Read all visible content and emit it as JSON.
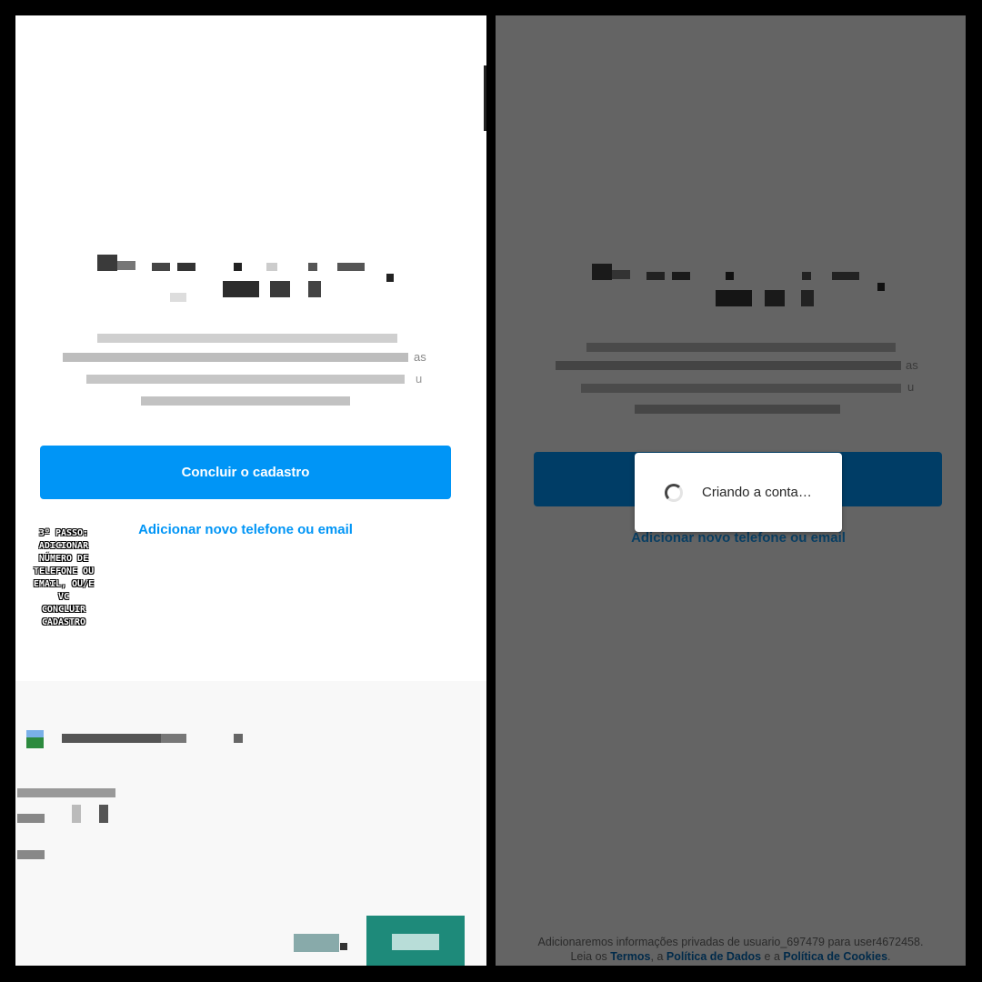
{
  "left_screen": {
    "primary_button_label": "Concluir o cadastro",
    "secondary_link_label": "Adicionar novo telefone ou email",
    "step_note_lines": [
      "3º PASSO:",
      "ADICIONAR",
      "NÚMERO DE",
      "TELEFONE OU",
      "EMAIL, OU/E VC",
      "CONCLUIR",
      "CADASTRO"
    ],
    "blurred_text_fragment_1": "as",
    "blurred_text_fragment_2": "u"
  },
  "right_screen": {
    "secondary_link_label": "Adicionar novo telefone ou email",
    "loading_dialog_text": "Criando a conta…",
    "blurred_text_fragment_1": "as",
    "blurred_text_fragment_2": "u",
    "footer": {
      "line1": "Adicionaremos informações privadas de usuario_697479 para user4672458.",
      "prefix": "Leia os ",
      "terms": "Termos",
      "sep1": ", a ",
      "data_policy": "Política de Dados",
      "sep2": " e a ",
      "cookies_policy": "Política de Cookies",
      "end": "."
    }
  },
  "colors": {
    "accent_blue": "#0095f6",
    "dimmed_button": "#003d66",
    "overlay_gray": "#646464",
    "teal_tile": "#1e8a7a"
  }
}
